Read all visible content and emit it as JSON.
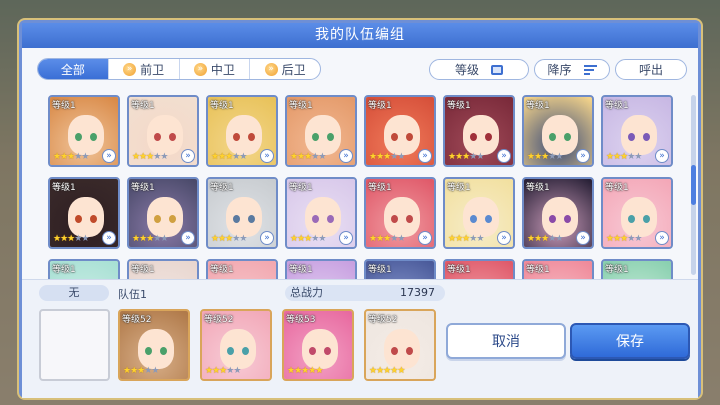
{
  "dialog": {
    "title": "我的队伍编组"
  },
  "tabs": [
    {
      "label": "全部",
      "active": true,
      "icon": null
    },
    {
      "label": "前卫",
      "active": false,
      "icon": "chevron-right-icon"
    },
    {
      "label": "中卫",
      "active": false,
      "icon": "chevron-right-icon"
    },
    {
      "label": "后卫",
      "active": false,
      "icon": "chevron-right-icon"
    }
  ],
  "sort": {
    "level_label": "等级",
    "order_label": "降序",
    "call_label": "呼出"
  },
  "roster": {
    "level_label": "等级1",
    "rows": [
      [
        {
          "stars": 3,
          "hair": "#d98a48",
          "eye": "#4aa06a",
          "bg": "#f0c49a"
        },
        {
          "stars": 3,
          "hair": "#f2dfd0",
          "eye": "#c04a4a",
          "bg": "#f4d8c8"
        },
        {
          "stars": 3,
          "hair": "#e8c25a",
          "eye": "#c04a3a",
          "bg": "#f3d68a"
        },
        {
          "stars": 3,
          "hair": "#e49a6a",
          "eye": "#4aa06a",
          "bg": "#f2b892"
        },
        {
          "stars": 3,
          "hair": "#d6503a",
          "eye": "#c04a3a",
          "bg": "#f07a5a"
        },
        {
          "stars": 3,
          "hair": "#7a2a3a",
          "eye": "#a0303a",
          "bg": "#a04a58"
        },
        {
          "stars": 3,
          "hair": "#f2d28a",
          "eye": "#4aa06a",
          "bg": "#3a4a78"
        },
        {
          "stars": 3,
          "hair": "#c8b8e4",
          "eye": "#7a5ab8",
          "bg": "#dcd2ef"
        }
      ],
      [
        {
          "stars": 3,
          "hair": "#3a2a2a",
          "eye": "#c04a2a",
          "bg": "#2e1e22"
        },
        {
          "stars": 3,
          "hair": "#4a4a6a",
          "eye": "#d0a040",
          "bg": "#8a7aa8"
        },
        {
          "stars": 3,
          "hair": "#c8ccd0",
          "eye": "#5a7aa0",
          "bg": "#dfe2e6"
        },
        {
          "stars": 3,
          "hair": "#d8c8ea",
          "eye": "#9a6ab8",
          "bg": "#e9dff3"
        },
        {
          "stars": 3,
          "hair": "#e05a6a",
          "eye": "#c04a4a",
          "bg": "#f09aa0"
        },
        {
          "stars": 3,
          "hair": "#f2e0a0",
          "eye": "#5a8ad0",
          "bg": "#f6ecc8"
        },
        {
          "stars": 3,
          "hair": "#2a2238",
          "eye": "#8a4aa8",
          "bg": "#c89ab8"
        },
        {
          "stars": 3,
          "hair": "#f4a8b8",
          "eye": "#4aa0a8",
          "bg": "#f7c8d4"
        }
      ],
      [
        {
          "stars": 0,
          "hair": "#a8e0d4",
          "eye": "#5a8ad0",
          "bg": "#cdeee6"
        },
        {
          "stars": 0,
          "hair": "#e8d6cf",
          "eye": "#5a8ad0",
          "bg": "#f2e6e2"
        },
        {
          "stars": 0,
          "hair": "#f2a8b0",
          "eye": "#5a8ad0",
          "bg": "#f6c8cc"
        },
        {
          "stars": 0,
          "hair": "#c8a0e0",
          "eye": "#5a8ad0",
          "bg": "#e2d0f2"
        },
        {
          "stars": 0,
          "hair": "#4a5a9a",
          "eye": "#5a8ad0",
          "bg": "#8a9ad0"
        },
        {
          "stars": 0,
          "hair": "#e05a6a",
          "eye": "#5a8ad0",
          "bg": "#f0a0a8"
        },
        {
          "stars": 0,
          "hair": "#f08a9a",
          "eye": "#5a8ad0",
          "bg": "#f6c0c8"
        },
        {
          "stars": 0,
          "hair": "#8ad0b0",
          "eye": "#5a8ad0",
          "bg": "#c8ecd8"
        }
      ]
    ]
  },
  "team": {
    "slot_label": "无",
    "name": "队伍1",
    "power_label": "总战力",
    "power_value": "17397",
    "members": [
      {
        "level": "等级52",
        "stars": 3,
        "hair": "#b07a4a",
        "eye": "#4aa06a",
        "bg": "#d9b08a"
      },
      {
        "level": "等级52",
        "stars": 3,
        "hair": "#f2a8b8",
        "eye": "#4aa0a8",
        "bg": "#f7cbd6"
      },
      {
        "level": "等级53",
        "stars": 5,
        "hair": "#e86aa0",
        "eye": "#c04a6a",
        "bg": "#f2a0c4"
      },
      {
        "level": "等级52",
        "stars": 5,
        "hair": "#eee6e0",
        "eye": "#c04a4a",
        "bg": "#f4ece6"
      }
    ]
  },
  "buttons": {
    "cancel": "取消",
    "save": "保存"
  }
}
